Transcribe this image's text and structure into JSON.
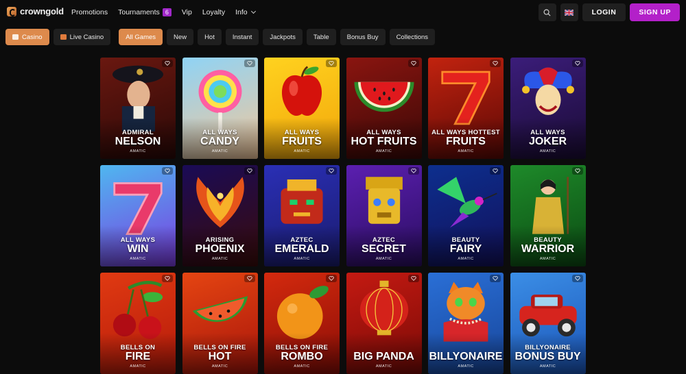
{
  "header": {
    "brand": "crowngold",
    "nav": [
      {
        "label": "Promotions"
      },
      {
        "label": "Tournaments",
        "badge": "6"
      },
      {
        "label": "Vip"
      },
      {
        "label": "Loyalty"
      },
      {
        "label": "Info"
      }
    ],
    "login_label": "LOGIN",
    "signup_label": "SIGN UP",
    "icons": {
      "search": "search-icon",
      "language": "uk-flag-icon",
      "brand": "crowngold-logo-icon"
    }
  },
  "filters": {
    "modes": [
      {
        "label": "Casino",
        "active": true,
        "icon": "casino-icon"
      },
      {
        "label": "Live Casino",
        "active": false,
        "icon": "live-icon"
      }
    ],
    "categories": [
      {
        "label": "All Games",
        "active": true
      },
      {
        "label": "New",
        "active": false
      },
      {
        "label": "Hot",
        "active": false
      },
      {
        "label": "Instant",
        "active": false
      },
      {
        "label": "Jackpots",
        "active": false
      },
      {
        "label": "Table",
        "active": false
      },
      {
        "label": "Bonus Buy",
        "active": false
      },
      {
        "label": "Collections",
        "active": false
      }
    ]
  },
  "colors": {
    "accent_orange": "#dd8a4c",
    "accent_purple": "#b320c9",
    "badge_purple": "#a128c9",
    "page_bg": "#0c0c0c",
    "surface": "#1f1f1f"
  },
  "games": [
    {
      "line1": "ADMIRAL",
      "line2": "NELSON",
      "provider": "AMATIC",
      "art": "admiral-portrait",
      "bg": "#6a1810,#2a0806"
    },
    {
      "line1": "ALL WAYS",
      "line2": "CANDY",
      "provider": "AMATIC",
      "art": "lollipop",
      "bg": "#8fd3f5,#f3c79a"
    },
    {
      "line1": "ALL WAYS",
      "line2": "FRUITS",
      "provider": "AMATIC",
      "art": "cherry-apple",
      "bg": "#ffd21f,#f2a60a"
    },
    {
      "line1": "ALL WAYS",
      "line2": "HOT FRUITS",
      "provider": "AMATIC",
      "art": "watermelon",
      "bg": "#8a1510,#3a0806"
    },
    {
      "line1": "ALL WAYS HOTTEST",
      "line2": "FRUITS",
      "provider": "AMATIC",
      "art": "seven",
      "bg": "#c2230f,#5a0805"
    },
    {
      "line1": "ALL WAYS",
      "line2": "JOKER",
      "provider": "AMATIC",
      "art": "joker",
      "bg": "#3b1d7a,#1a0b34"
    },
    {
      "line1": "ALL WAYS",
      "line2": "WIN",
      "provider": "AMATIC",
      "art": "seven-pink",
      "bg": "#4fb7f0,#7b3be0"
    },
    {
      "line1": "ARISING",
      "line2": "PHOENIX",
      "provider": "AMATIC",
      "art": "phoenix",
      "bg": "#1a0b56,#3a0b0a"
    },
    {
      "line1": "AZTEC",
      "line2": "EMERALD",
      "provider": "AMATIC",
      "art": "aztec-mask",
      "bg": "#2a2fb5,#1a1b6e"
    },
    {
      "line1": "AZTEC",
      "line2": "SECRET",
      "provider": "AMATIC",
      "art": "golden-idol",
      "bg": "#5b1fb0,#2a0d60"
    },
    {
      "line1": "BEAUTY",
      "line2": "FAIRY",
      "provider": "AMATIC",
      "art": "hummingbird",
      "bg": "#0d2f8e,#12105a"
    },
    {
      "line1": "BEAUTY",
      "line2": "WARRIOR",
      "provider": "AMATIC",
      "art": "warrior",
      "bg": "#1e8a2a,#0b4a12"
    },
    {
      "line1": "BELLS ON",
      "line2": "FIRE",
      "provider": "AMATIC",
      "art": "cherries",
      "bg": "#e03a12,#b51a0a"
    },
    {
      "line1": "BELLS ON FIRE",
      "line2": "HOT",
      "provider": "AMATIC",
      "art": "watermelon-slice",
      "bg": "#e54512,#a8150a"
    },
    {
      "line1": "BELLS ON FIRE",
      "line2": "ROMBO",
      "provider": "AMATIC",
      "art": "orange",
      "bg": "#d42a0e,#8a0d06"
    },
    {
      "line1": "",
      "line2": "BIG PANDA",
      "provider": "AMATIC",
      "art": "lantern",
      "bg": "#c41a12,#7a0a06"
    },
    {
      "line1": "",
      "line2": "BILLYONAIRE",
      "provider": "AMATIC",
      "art": "cat",
      "bg": "#2a6fd6,#17459a"
    },
    {
      "line1": "BILLYONAIRE",
      "line2": "BONUS BUY",
      "provider": "AMATIC",
      "art": "red-car",
      "bg": "#3b8ee6,#1b55b8"
    }
  ]
}
